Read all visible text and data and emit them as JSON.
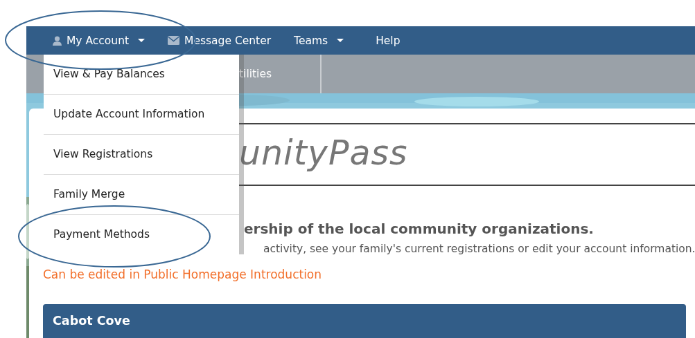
{
  "navbar": {
    "items": [
      {
        "label": "My Account",
        "kind": "account",
        "dropdown": true,
        "expanded": true,
        "menu": [
          "View & Pay Balances",
          "Update Account Information",
          "View Registrations",
          "Family Merge",
          "Payment Methods"
        ]
      },
      {
        "label": "Message Center",
        "kind": "messages",
        "dropdown": false
      },
      {
        "label": "Teams",
        "kind": "plain",
        "dropdown": true
      },
      {
        "label": "Help",
        "kind": "plain",
        "dropdown": false
      }
    ]
  },
  "subnav": {
    "items": [
      "tilities"
    ]
  },
  "logo": {
    "text": "unityPass"
  },
  "intro": {
    "heading": "ership of the local community organizations.",
    "text": "activity, see your family's current registrations or edit your account information.",
    "note": "Can be edited in Public Homepage Introduction"
  },
  "section": {
    "title": "Cabot Cove"
  },
  "annotations": [
    {
      "kind": "ellipse"
    },
    {
      "kind": "ellipse"
    }
  ]
}
